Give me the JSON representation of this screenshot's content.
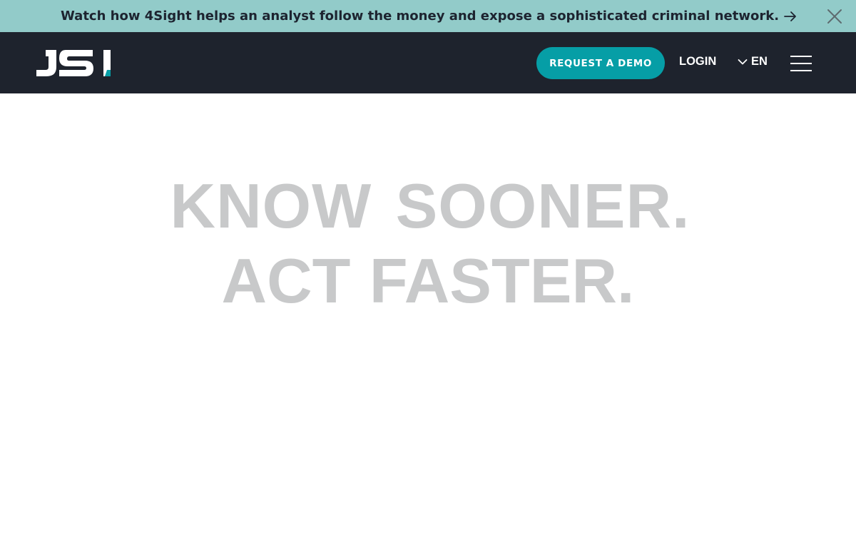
{
  "banner": {
    "text": "Watch how 4Sight helps an analyst follow the money and expose a sophisticated criminal network.",
    "arrow_icon": "arrow-right-icon",
    "close_icon": "close-icon"
  },
  "header": {
    "logo_text": "JSI",
    "demo_label": "REQUEST A DEMO",
    "login_label": "LOGIN",
    "language": "EN",
    "menu_icon": "hamburger-menu-icon"
  },
  "hero": {
    "line1": "KNOW SOONER.",
    "line2": "ACT FASTER."
  },
  "colors": {
    "banner_bg": "#92cbc9",
    "header_bg": "#1e232d",
    "accent": "#069ea6",
    "hero_text": "#c8c9ca"
  }
}
